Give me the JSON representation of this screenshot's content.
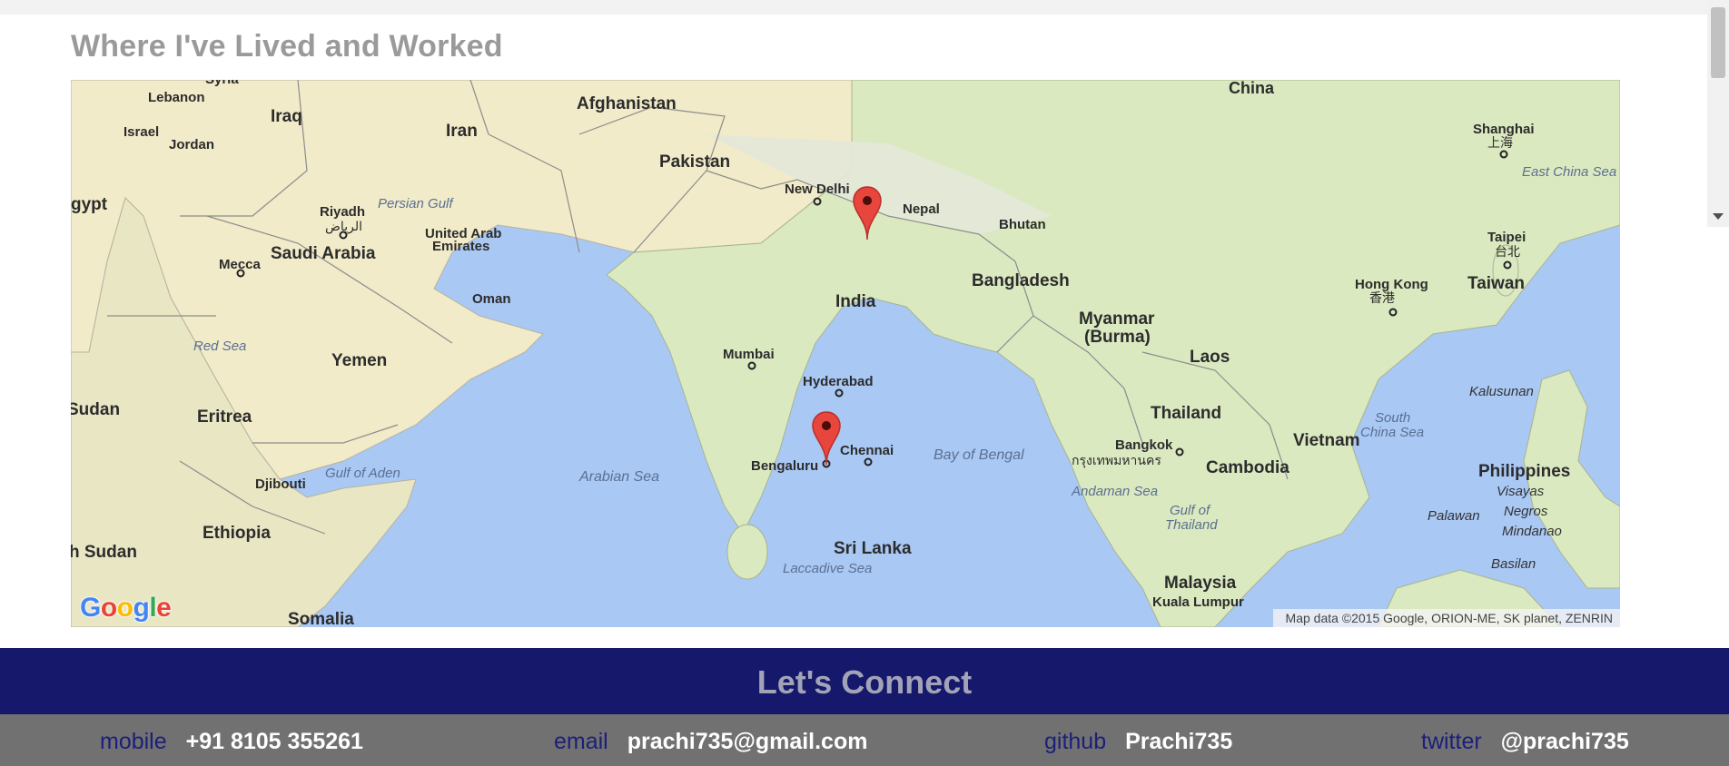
{
  "section": {
    "title": "Where I've Lived and Worked"
  },
  "map": {
    "attribution": "Map data ©2015 Google, ORION-ME, SK planet, ZENRIN",
    "logo_text": "Google",
    "labels": {
      "china": "China",
      "afghanistan": "Afghanistan",
      "pakistan": "Pakistan",
      "iran": "Iran",
      "iraq": "Iraq",
      "syria": "Syria",
      "lebanon": "Lebanon",
      "israel": "Israel",
      "jordan": "Jordan",
      "egypt": "gypt",
      "saudi": "Saudi Arabia",
      "riyadh": "Riyadh",
      "riyadh_ar": "الرياض",
      "mecca": "Mecca",
      "persian_gulf": "Persian Gulf",
      "uae1": "United Arab",
      "uae2": "Emirates",
      "oman": "Oman",
      "yemen": "Yemen",
      "red_sea": "Red Sea",
      "sudan": "Sudan",
      "eritrea": "Eritrea",
      "djibouti": "Djibouti",
      "gulf_aden": "Gulf of Aden",
      "ethiopia": "Ethiopia",
      "s_sudan": "h Sudan",
      "somalia": "Somalia",
      "new_delhi": "New Delhi",
      "nepal": "Nepal",
      "bhutan": "Bhutan",
      "india": "India",
      "bangladesh": "Bangladesh",
      "myanmar1": "Myanmar",
      "myanmar2": "(Burma)",
      "mumbai": "Mumbai",
      "hyderabad": "Hyderabad",
      "chennai": "Chennai",
      "bengaluru": "Bengaluru",
      "arabian_sea": "Arabian Sea",
      "bay_bengal": "Bay of Bengal",
      "sri_lanka": "Sri Lanka",
      "laccadive": "Laccadive Sea",
      "laos": "Laos",
      "thailand": "Thailand",
      "bangkok": "Bangkok",
      "bangkok_th": "กรุงเทพมหานคร",
      "andaman": "Andaman Sea",
      "gulf_thai1": "Gulf of",
      "gulf_thai2": "Thailand",
      "cambodia": "Cambodia",
      "vietnam": "Vietnam",
      "malaysia": "Malaysia",
      "kuala": "Kuala Lumpur",
      "south_china1": "South",
      "south_china2": "China Sea",
      "shanghai": "Shanghai",
      "shanghai_zh": "上海",
      "east_china": "East China Sea",
      "taipei": "Taipei",
      "taipei_zh": "台北",
      "taiwan": "Taiwan",
      "hongkong": "Hong Kong",
      "hongkong_zh": "香港",
      "philippines": "Philippines",
      "visayas": "Visayas",
      "negros": "Negros",
      "mindanao": "Mindanao",
      "palawan": "Palawan",
      "basilan": "Basilan",
      "kalusunan": "Kalusunan"
    }
  },
  "connect": {
    "title": "Let's Connect"
  },
  "contacts": {
    "mobile": {
      "label": "mobile",
      "value": "+91 8105 355261"
    },
    "email": {
      "label": "email",
      "value": "prachi735@gmail.com"
    },
    "github": {
      "label": "github",
      "value": "Prachi735"
    },
    "twitter": {
      "label": "twitter",
      "value": "@prachi735"
    }
  },
  "colors": {
    "connect_bg": "#15186b",
    "contact_bg": "#717171",
    "marker": "#e8453c",
    "water": "#a9c8f4",
    "land": "#eef0d6",
    "desert": "#f4ecca",
    "vegetation": "#cfe3b3"
  }
}
